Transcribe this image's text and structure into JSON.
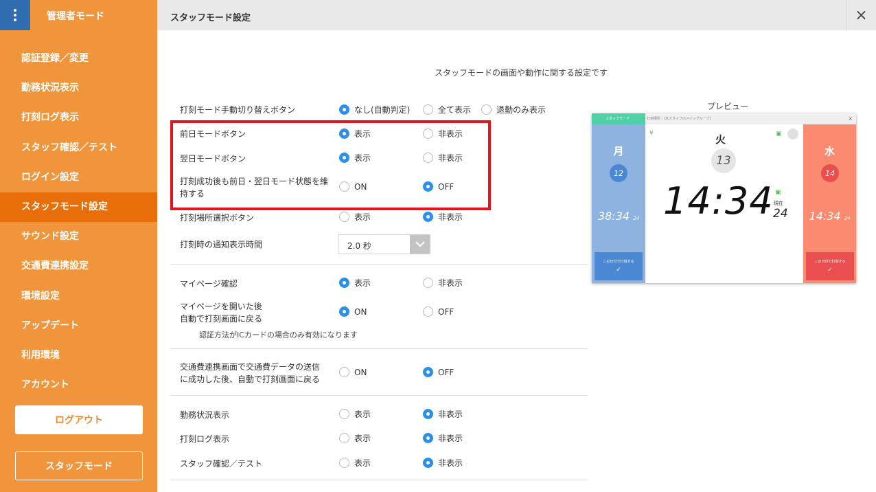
{
  "sidebar": {
    "title": "管理者モード",
    "items": [
      {
        "label": "認証登録／変更"
      },
      {
        "label": "勤務状況表示"
      },
      {
        "label": "打刻ログ表示"
      },
      {
        "label": "スタッフ確認／テスト"
      },
      {
        "label": "ログイン設定"
      },
      {
        "label": "スタッフモード設定",
        "active": true
      },
      {
        "label": "サウンド設定"
      },
      {
        "label": "交通費連携設定"
      },
      {
        "label": "環境設定"
      },
      {
        "label": "アップデート"
      },
      {
        "label": "利用環境"
      },
      {
        "label": "アカウント"
      }
    ],
    "logout_label": "ログアウト",
    "staff_mode_label": "スタッフモード"
  },
  "header": {
    "title": "スタッフモード設定",
    "close_icon": "×"
  },
  "main": {
    "subtitle": "スタッフモードの画面や動作に関する設定です",
    "settings": [
      {
        "label": "打刻モード手動切り替えボタン",
        "options": [
          {
            "label": "なし(自動判定)",
            "selected": true
          },
          {
            "label": "全て表示",
            "selected": false
          },
          {
            "label": "退勤のみ表示",
            "selected": false
          }
        ]
      },
      {
        "label": "前日モードボタン",
        "options": [
          {
            "label": "表示",
            "selected": true
          },
          {
            "label": "非表示",
            "selected": false
          }
        ]
      },
      {
        "label": "翌日モードボタン",
        "options": [
          {
            "label": "表示",
            "selected": true
          },
          {
            "label": "非表示",
            "selected": false
          }
        ]
      },
      {
        "label_line1": "打刻成功後も前日・翌日モード状態を維",
        "label_line2": "持する",
        "options": [
          {
            "label": "ON",
            "selected": false
          },
          {
            "label": "OFF",
            "selected": true
          }
        ]
      },
      {
        "label": "打刻場所選択ボタン",
        "options": [
          {
            "label": "表示",
            "selected": false
          },
          {
            "label": "非表示",
            "selected": true
          }
        ]
      },
      {
        "label": "打刻時の通知表示時間",
        "select_value": "2.0 秒"
      },
      {
        "label": "マイページ確認",
        "options": [
          {
            "label": "表示",
            "selected": true
          },
          {
            "label": "非表示",
            "selected": false
          }
        ]
      },
      {
        "label_line1": "マイページを開いた後",
        "label_line2": "自動で打刻画面に戻る",
        "options": [
          {
            "label": "ON",
            "selected": true
          },
          {
            "label": "OFF",
            "selected": false
          }
        ],
        "note": "認証方法がICカードの場合のみ有効になります"
      },
      {
        "label_line1": "交通費連携画面で交通費データの送信",
        "label_line2": "に成功した後、自動で打刻画面に戻る",
        "options": [
          {
            "label": "ON",
            "selected": false
          },
          {
            "label": "OFF",
            "selected": true
          }
        ]
      },
      {
        "label": "勤務状況表示",
        "options": [
          {
            "label": "表示",
            "selected": false
          },
          {
            "label": "非表示",
            "selected": true
          }
        ]
      },
      {
        "label": "打刻ログ表示",
        "options": [
          {
            "label": "表示",
            "selected": false
          },
          {
            "label": "非表示",
            "selected": true
          }
        ]
      },
      {
        "label": "スタッフ確認／テスト",
        "options": [
          {
            "label": "表示",
            "selected": false
          },
          {
            "label": "非表示",
            "selected": true
          }
        ]
      }
    ]
  },
  "preview": {
    "label": "プレビュー",
    "top_left_label": "スタッフモード",
    "place_label": "打刻場所｜(本スタッフのメイングループ)",
    "close": "×",
    "prev": {
      "day": "月",
      "date": "12",
      "time": "38:34",
      "sec": "24",
      "button": "この日付で打刻する"
    },
    "current": {
      "day": "火",
      "date": "13",
      "time": "14:34",
      "now_label": "現在",
      "sec": "24"
    },
    "next": {
      "day": "水",
      "date": "14",
      "time": "14:34",
      "sec": "24",
      "button": "この日付で打刻する"
    },
    "check": "✓",
    "icon_yen": "¥",
    "icon_card": "▣"
  },
  "colors": {
    "sidebar": "#f0953b",
    "sidebar_active": "#e86e0a",
    "menu_button": "#2f6db0",
    "radio_on": "#2f8ee5",
    "highlight": "#e4141b"
  }
}
